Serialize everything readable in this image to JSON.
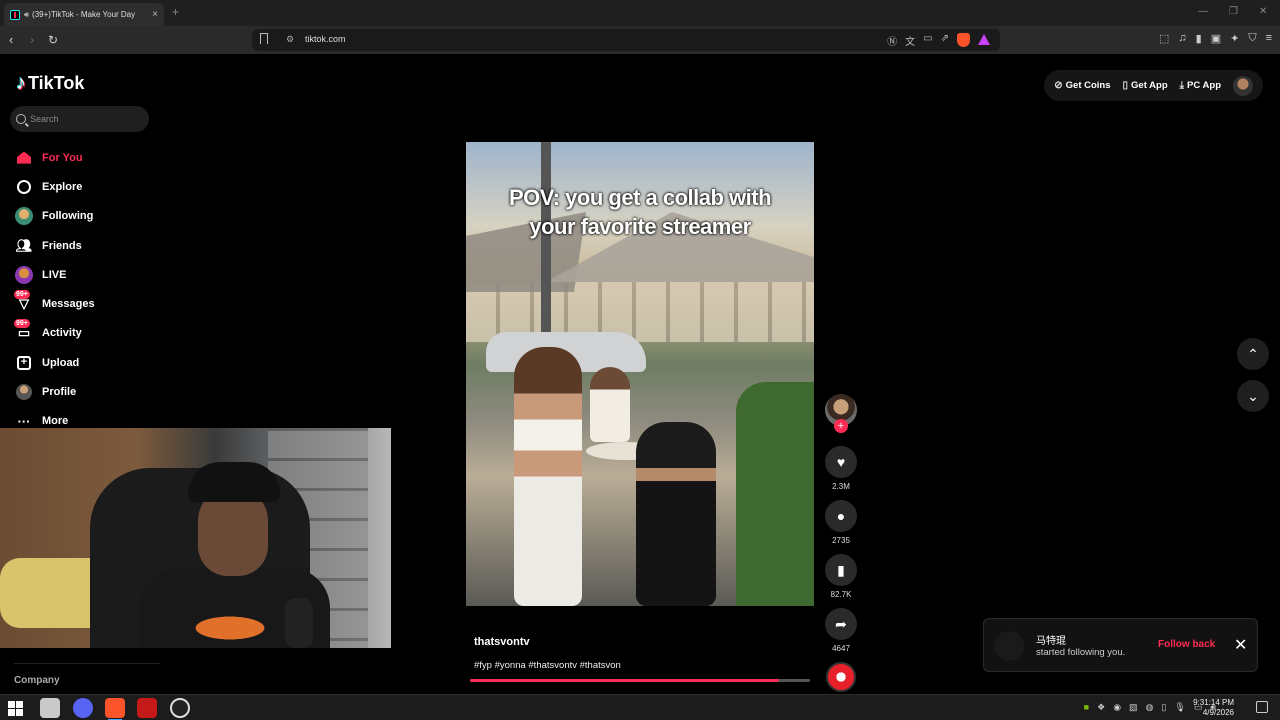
{
  "browser": {
    "tab_title": "(39+)TikTok - Make Your Day",
    "tab_close": "×",
    "new_tab": "+",
    "url": "tiktok.com",
    "window_controls": [
      "—",
      "❐",
      "✕"
    ]
  },
  "tiktok": {
    "logo_text": "TikTok",
    "search_placeholder": "Search",
    "nav": [
      {
        "label": "For You",
        "icon": "home-icon",
        "active": true
      },
      {
        "label": "Explore",
        "icon": "compass-icon"
      },
      {
        "label": "Following",
        "icon": "following-avatar-icon"
      },
      {
        "label": "Friends",
        "icon": "friends-icon"
      },
      {
        "label": "LIVE",
        "icon": "live-avatar-icon"
      },
      {
        "label": "Messages",
        "icon": "messages-icon",
        "badge": "99+"
      },
      {
        "label": "Activity",
        "icon": "activity-icon",
        "badge": "99+"
      },
      {
        "label": "Upload",
        "icon": "upload-icon"
      },
      {
        "label": "Profile",
        "icon": "profile-avatar-icon"
      },
      {
        "label": "More",
        "icon": "more-icon"
      }
    ],
    "company_label": "Company",
    "top_actions": {
      "get_coins": "Get Coins",
      "get_app": "Get App",
      "pc_app": "PC App"
    },
    "video": {
      "overlay_line1": "POV: you get a collab with",
      "overlay_line2": "your favorite streamer",
      "author": "thatsvontv",
      "hashtags": "#fyp #yonna #thatsvontv #thatsvon",
      "progress_fraction": 0.91
    },
    "stats": {
      "likes": "2.3M",
      "comments": "2735",
      "bookmarks": "82.7K",
      "shares": "4647"
    },
    "toast": {
      "name": "马特琨",
      "message": "started following you.",
      "follow_back": "Follow back",
      "close": "✕"
    }
  },
  "taskbar": {
    "time": "9:31:14 PM",
    "date": "4/9/2026"
  },
  "colors": {
    "tiktok_red": "#fe2c55",
    "background": "#000000"
  }
}
